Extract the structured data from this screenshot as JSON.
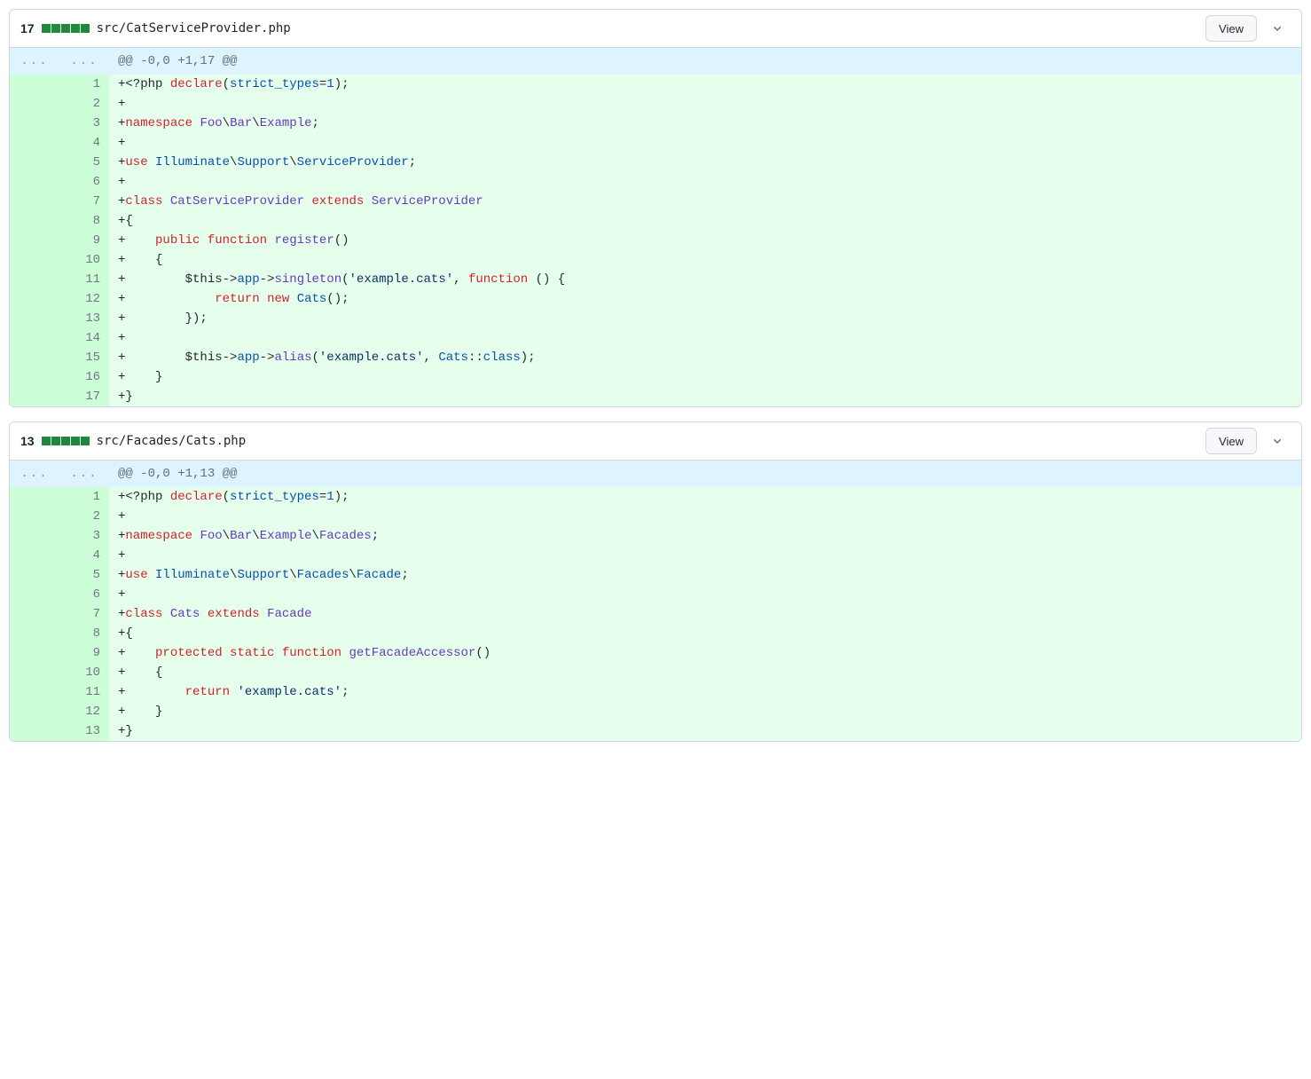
{
  "buttons": {
    "view": "View"
  },
  "files": [
    {
      "lines_changed": "17",
      "squares": [
        "add",
        "add",
        "add",
        "add",
        "add"
      ],
      "path": "src/CatServiceProvider.php",
      "hunk": "@@ -0,0 +1,17 @@",
      "rows": [
        {
          "n": "1",
          "html": "<span class='marker'>+</span>&lt;?php <span class='pl-k'>declare</span>(<span class='pl-c1'>strict_types</span>=<span class='pl-c1'>1</span>);"
        },
        {
          "n": "2",
          "html": "<span class='marker'>+</span>"
        },
        {
          "n": "3",
          "html": "<span class='marker'>+</span><span class='pl-k'>namespace</span> <span class='pl-en'>Foo</span>\\<span class='pl-en'>Bar</span>\\<span class='pl-en'>Example</span>;"
        },
        {
          "n": "4",
          "html": "<span class='marker'>+</span>"
        },
        {
          "n": "5",
          "html": "<span class='marker'>+</span><span class='pl-k'>use</span> <span class='pl-c1'>Illuminate</span>\\<span class='pl-c1'>Support</span>\\<span class='pl-c1'>ServiceProvider</span>;"
        },
        {
          "n": "6",
          "html": "<span class='marker'>+</span>"
        },
        {
          "n": "7",
          "html": "<span class='marker'>+</span><span class='pl-k'>class</span> <span class='pl-en'>CatServiceProvider</span> <span class='pl-k'>extends</span> <span class='pl-en'>ServiceProvider</span>"
        },
        {
          "n": "8",
          "html": "<span class='marker'>+</span>{"
        },
        {
          "n": "9",
          "html": "<span class='marker'>+</span>    <span class='pl-k'>public</span> <span class='pl-k'>function</span> <span class='pl-en'>register</span>()"
        },
        {
          "n": "10",
          "html": "<span class='marker'>+</span>    {"
        },
        {
          "n": "11",
          "html": "<span class='marker'>+</span>        <span class='pl-smi'>$this</span>-&gt;<span class='pl-c1'>app</span>-&gt;<span class='pl-en'>singleton</span>(<span class='pl-s'>'example.cats'</span>, <span class='pl-k'>function</span> () {"
        },
        {
          "n": "12",
          "html": "<span class='marker'>+</span>            <span class='pl-k'>return</span> <span class='pl-k'>new</span> <span class='pl-c1'>Cats</span>();"
        },
        {
          "n": "13",
          "html": "<span class='marker'>+</span>        });"
        },
        {
          "n": "14",
          "html": "<span class='marker'>+</span>"
        },
        {
          "n": "15",
          "html": "<span class='marker'>+</span>        <span class='pl-smi'>$this</span>-&gt;<span class='pl-c1'>app</span>-&gt;<span class='pl-en'>alias</span>(<span class='pl-s'>'example.cats'</span>, <span class='pl-c1'>Cats</span>::<span class='pl-c1'>class</span>);"
        },
        {
          "n": "16",
          "html": "<span class='marker'>+</span>    }"
        },
        {
          "n": "17",
          "html": "<span class='marker'>+</span>}"
        }
      ]
    },
    {
      "lines_changed": "13",
      "squares": [
        "add",
        "add",
        "add",
        "add",
        "add"
      ],
      "path": "src/Facades/Cats.php",
      "hunk": "@@ -0,0 +1,13 @@",
      "rows": [
        {
          "n": "1",
          "html": "<span class='marker'>+</span>&lt;?php <span class='pl-k'>declare</span>(<span class='pl-c1'>strict_types</span>=<span class='pl-c1'>1</span>);"
        },
        {
          "n": "2",
          "html": "<span class='marker'>+</span>"
        },
        {
          "n": "3",
          "html": "<span class='marker'>+</span><span class='pl-k'>namespace</span> <span class='pl-en'>Foo</span>\\<span class='pl-en'>Bar</span>\\<span class='pl-en'>Example</span>\\<span class='pl-en'>Facades</span>;"
        },
        {
          "n": "4",
          "html": "<span class='marker'>+</span>"
        },
        {
          "n": "5",
          "html": "<span class='marker'>+</span><span class='pl-k'>use</span> <span class='pl-c1'>Illuminate</span>\\<span class='pl-c1'>Support</span>\\<span class='pl-c1'>Facades</span>\\<span class='pl-c1'>Facade</span>;"
        },
        {
          "n": "6",
          "html": "<span class='marker'>+</span>"
        },
        {
          "n": "7",
          "html": "<span class='marker'>+</span><span class='pl-k'>class</span> <span class='pl-en'>Cats</span> <span class='pl-k'>extends</span> <span class='pl-en'>Facade</span>"
        },
        {
          "n": "8",
          "html": "<span class='marker'>+</span>{"
        },
        {
          "n": "9",
          "html": "<span class='marker'>+</span>    <span class='pl-k'>protected</span> <span class='pl-k'>static</span> <span class='pl-k'>function</span> <span class='pl-en'>getFacadeAccessor</span>()"
        },
        {
          "n": "10",
          "html": "<span class='marker'>+</span>    {"
        },
        {
          "n": "11",
          "html": "<span class='marker'>+</span>        <span class='pl-k'>return</span> <span class='pl-s'>'example.cats'</span>;"
        },
        {
          "n": "12",
          "html": "<span class='marker'>+</span>    }"
        },
        {
          "n": "13",
          "html": "<span class='marker'>+</span>}"
        }
      ]
    }
  ]
}
